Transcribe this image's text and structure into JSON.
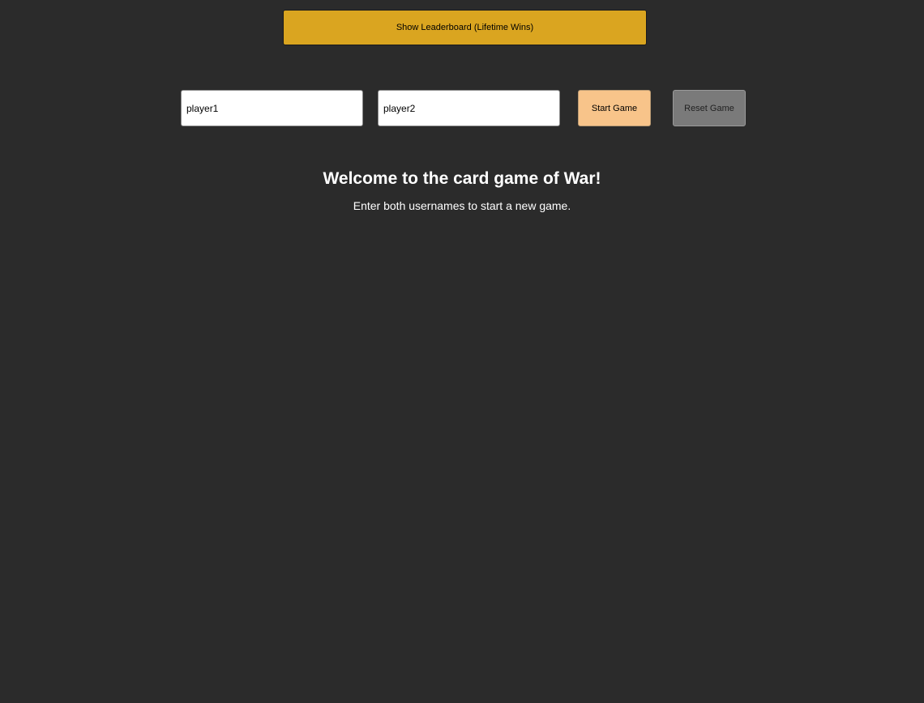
{
  "leaderboard": {
    "button_label": "Show Leaderboard (Lifetime Wins)"
  },
  "controls": {
    "player1_value": "player1",
    "player2_value": "player2",
    "start_label": "Start Game",
    "reset_label": "Reset Game"
  },
  "message": {
    "heading": "Welcome to the card game of War!",
    "subtext": "Enter both usernames to start a new game."
  },
  "colors": {
    "background": "#2b2b2b",
    "leaderboard_button": "#daa520",
    "start_button": "#f8c48a",
    "reset_button": "#7a7a7a",
    "text": "#ffffff"
  }
}
